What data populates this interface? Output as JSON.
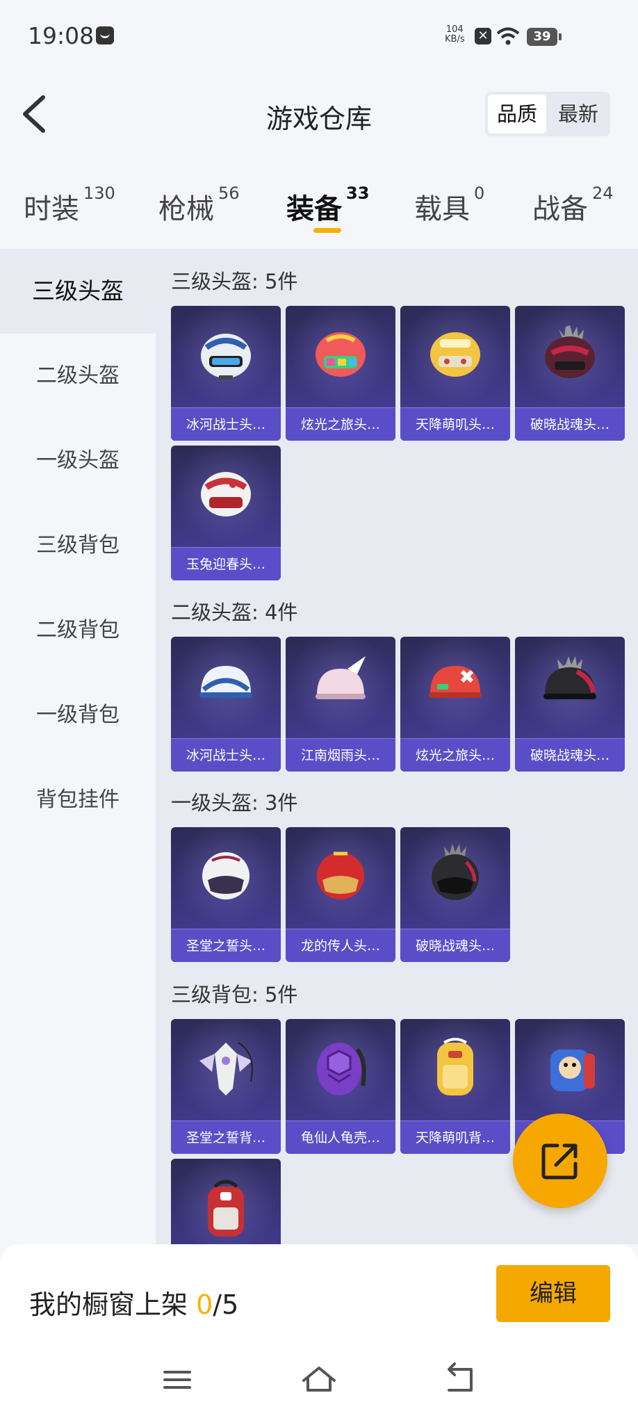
{
  "status_bar": {
    "time": "19:08",
    "net_speed": "104",
    "net_unit": "KB/s",
    "battery": "39"
  },
  "header": {
    "title": "游戏仓库",
    "sort": [
      "品质",
      "最新"
    ]
  },
  "tabs": [
    {
      "label": "时装",
      "count": "130"
    },
    {
      "label": "枪械",
      "count": "56"
    },
    {
      "label": "装备",
      "count": "33"
    },
    {
      "label": "载具",
      "count": "0"
    },
    {
      "label": "战备",
      "count": "24"
    }
  ],
  "sidebar": [
    "三级头盔",
    "二级头盔",
    "一级头盔",
    "三级背包",
    "二级背包",
    "一级背包",
    "背包挂件"
  ],
  "sections": [
    {
      "title": "三级头盔: 5件",
      "items": [
        "冰河战士头…",
        "炫光之旅头…",
        "天降萌叽头…",
        "破晓战魂头…",
        "玉兔迎春头…"
      ]
    },
    {
      "title": "二级头盔: 4件",
      "items": [
        "冰河战士头…",
        "江南烟雨头…",
        "炫光之旅头…",
        "破晓战魂头…"
      ]
    },
    {
      "title": "一级头盔: 3件",
      "items": [
        "圣堂之誓头…",
        "龙的传人头…",
        "破晓战魂头…"
      ]
    },
    {
      "title": "三级背包: 5件",
      "items": [
        "圣堂之誓背…",
        "龟仙人龟壳…",
        "天降萌叽背…",
        "",
        ""
      ]
    }
  ],
  "bottom": {
    "shelf_label": "我的橱窗上架 ",
    "shelf_count": "0",
    "shelf_total": "/5",
    "edit_label": "编辑"
  },
  "colors": {
    "accent": "#f5a800",
    "card_label": "#5a4ec8",
    "card_bg": "#3a357a"
  },
  "icons": [
    "back-chevron-icon",
    "share-export-icon",
    "menu-icon",
    "home-icon",
    "back-icon",
    "wifi-icon"
  ]
}
